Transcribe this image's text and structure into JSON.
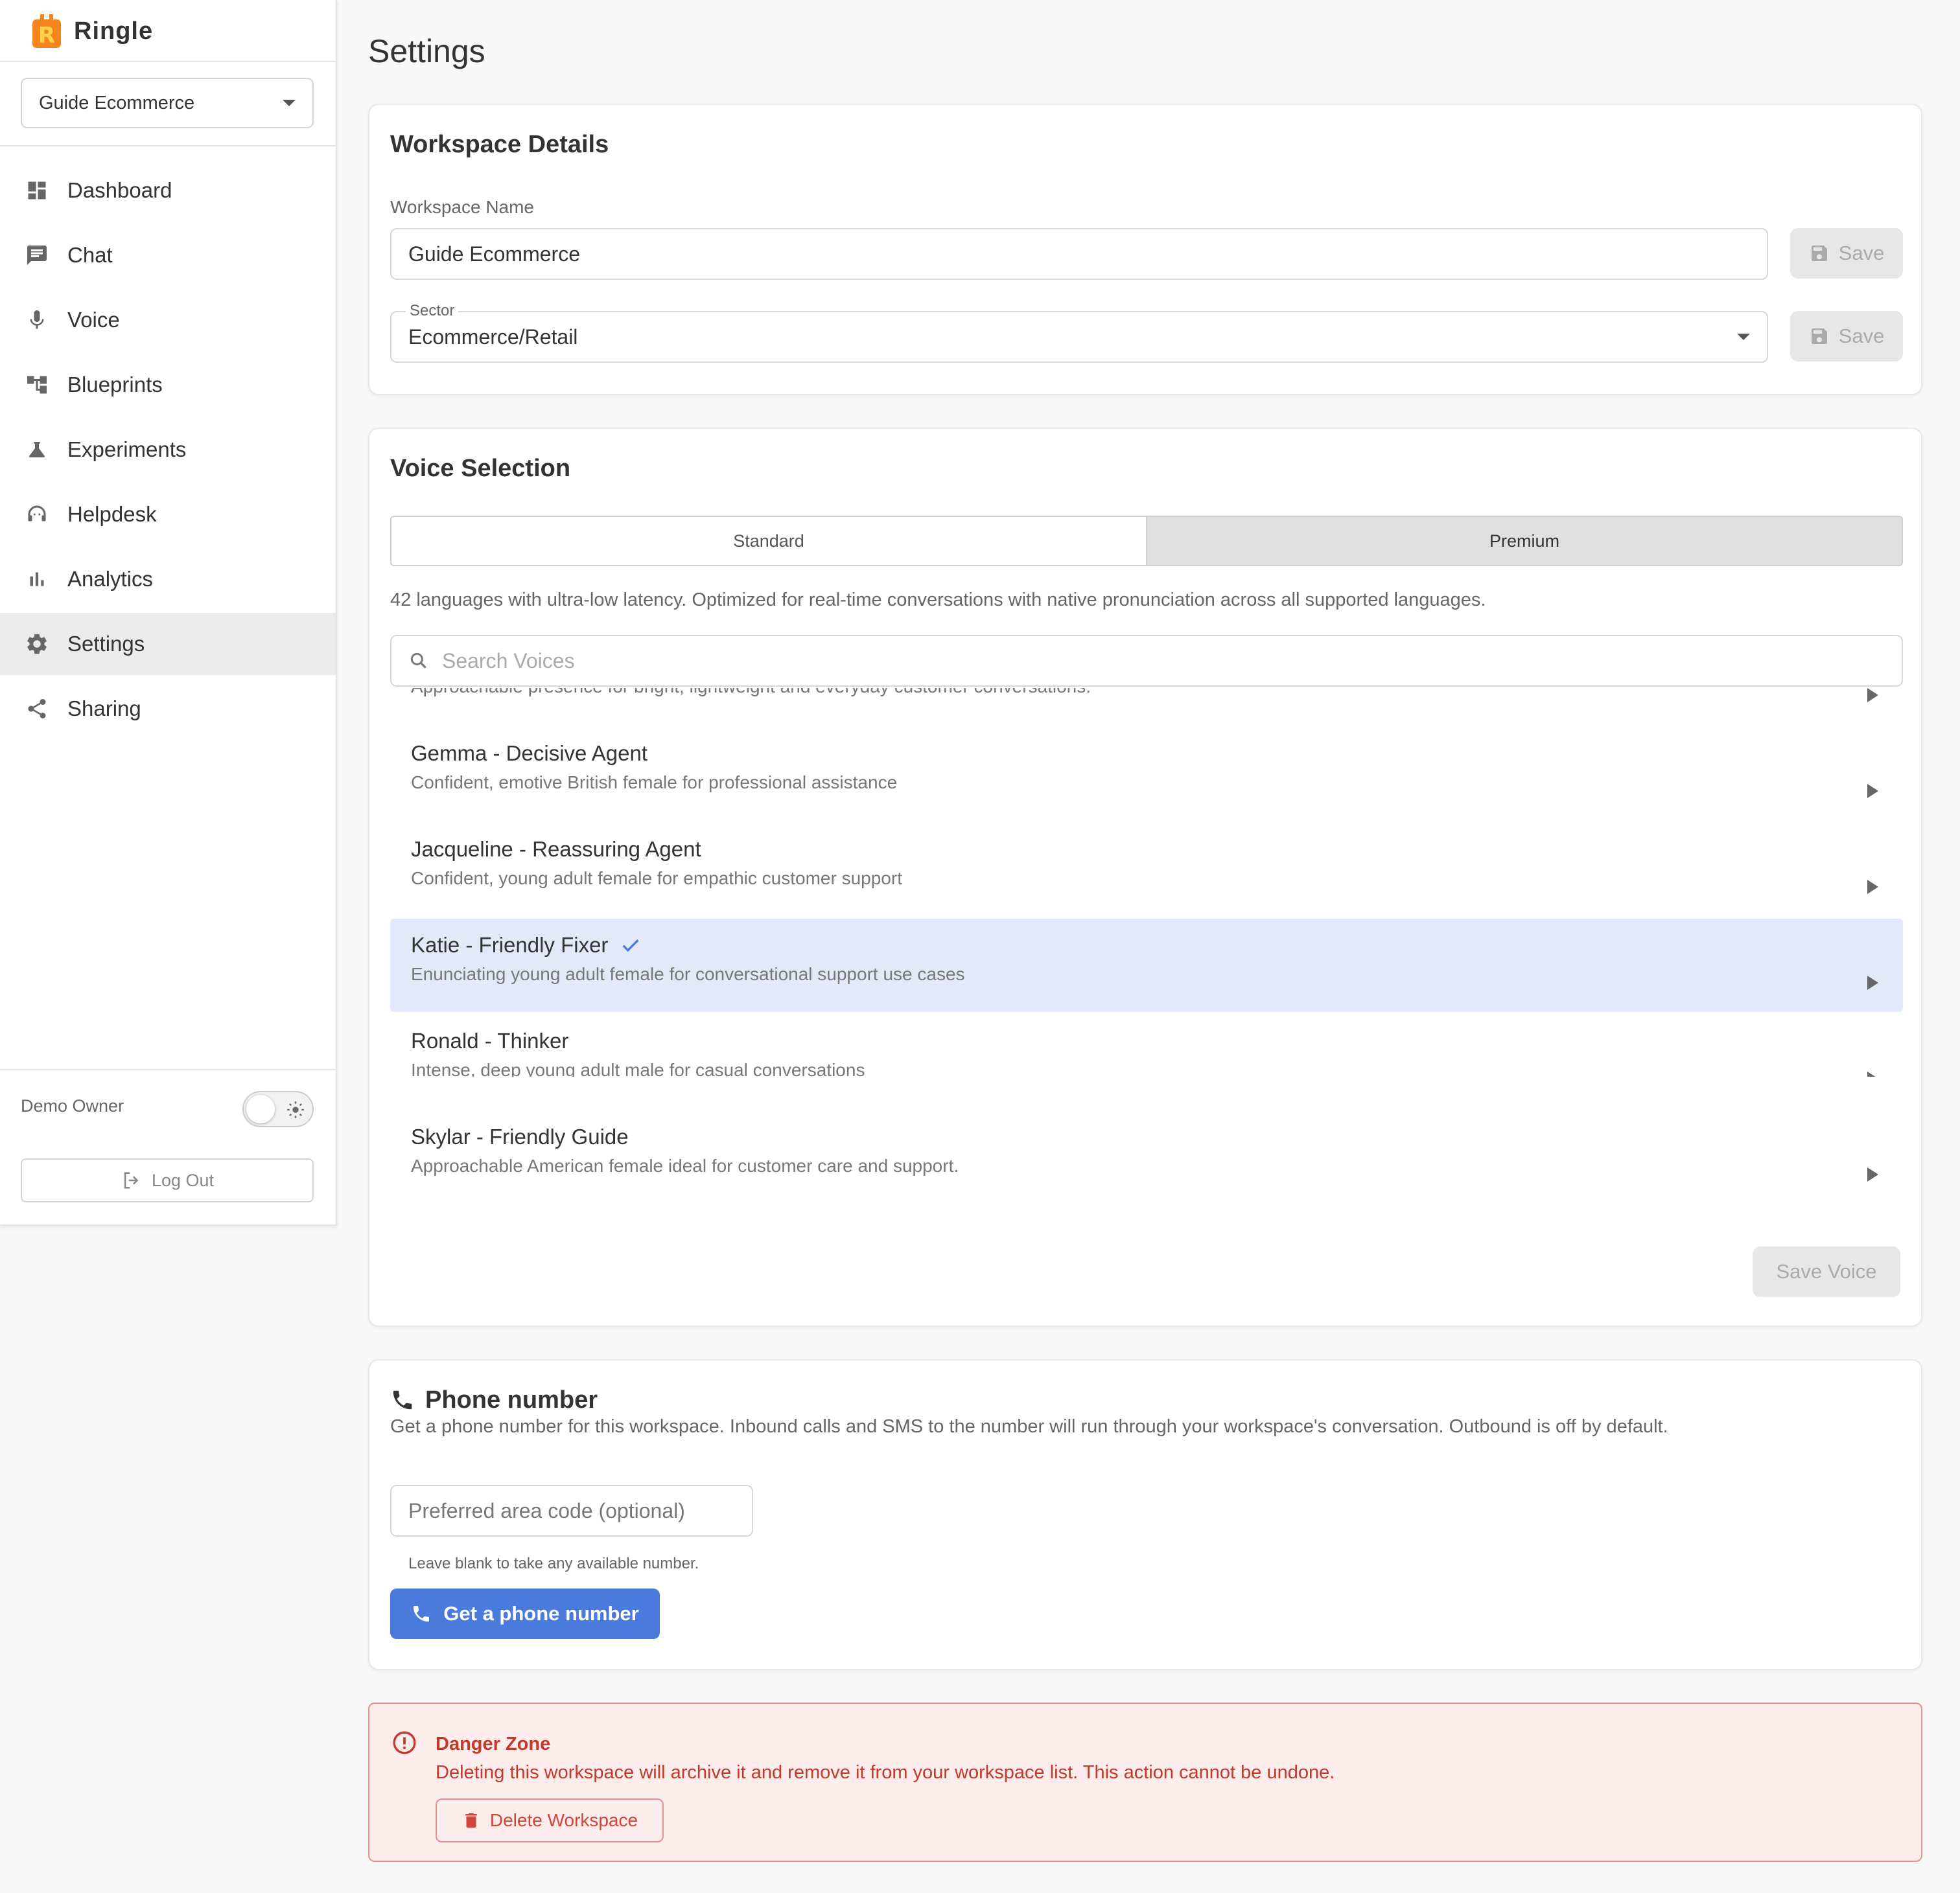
{
  "app": {
    "name": "Ringle"
  },
  "sidebar": {
    "workspace_select": "Guide Ecommerce",
    "items": [
      {
        "label": "Dashboard",
        "icon": "dashboard-icon"
      },
      {
        "label": "Chat",
        "icon": "chat-icon"
      },
      {
        "label": "Voice",
        "icon": "microphone-icon"
      },
      {
        "label": "Blueprints",
        "icon": "blueprints-icon"
      },
      {
        "label": "Experiments",
        "icon": "flask-icon"
      },
      {
        "label": "Helpdesk",
        "icon": "headset-icon"
      },
      {
        "label": "Analytics",
        "icon": "bar-chart-icon"
      },
      {
        "label": "Settings",
        "icon": "gear-icon",
        "active": true
      },
      {
        "label": "Sharing",
        "icon": "share-icon"
      }
    ],
    "user": "Demo Owner",
    "logout_label": "Log Out"
  },
  "page": {
    "title": "Settings"
  },
  "workspace_details": {
    "title": "Workspace Details",
    "name_label": "Workspace Name",
    "name_value": "Guide Ecommerce",
    "sector_label": "Sector",
    "sector_value": "Ecommerce/Retail",
    "save_label": "Save"
  },
  "voice_selection": {
    "title": "Voice Selection",
    "tabs": [
      {
        "label": "Standard"
      },
      {
        "label": "Premium",
        "selected": true
      }
    ],
    "description": "42 languages with ultra-low latency. Optimized for real-time conversations with native pronunciation across all supported languages.",
    "search_placeholder": "Search Voices",
    "partial_row_desc": "Approachable presence for bright, lightweight and everyday customer conversations.",
    "voices": [
      {
        "name": "Gemma - Decisive Agent",
        "desc": "Confident, emotive British female for professional assistance"
      },
      {
        "name": "Jacqueline - Reassuring Agent",
        "desc": "Confident, young adult female for empathic customer support"
      },
      {
        "name": "Katie - Friendly Fixer",
        "desc": "Enunciating young adult female for conversational support use cases",
        "selected": true
      },
      {
        "name": "Ronald - Thinker",
        "desc": "Intense, deep young adult male for casual conversations"
      },
      {
        "name": "Skylar - Friendly Guide",
        "desc": "Approachable American female ideal for customer care and support."
      }
    ],
    "save_voice_label": "Save Voice"
  },
  "phone": {
    "title": "Phone number",
    "description": "Get a phone number for this workspace. Inbound calls and SMS to the number will run through your workspace's conversation. Outbound is off by default.",
    "area_code_placeholder": "Preferred area code (optional)",
    "hint": "Leave blank to take any available number.",
    "button_label": "Get a phone number"
  },
  "danger": {
    "title": "Danger Zone",
    "text": "Deleting this workspace will archive it and remove it from your workspace list. This action cannot be undone.",
    "button_label": "Delete Workspace"
  },
  "colors": {
    "accent": "#4a7bdc",
    "selected_row": "#e3e9f8",
    "danger": "#c0392b",
    "brand": "#f5861f"
  }
}
